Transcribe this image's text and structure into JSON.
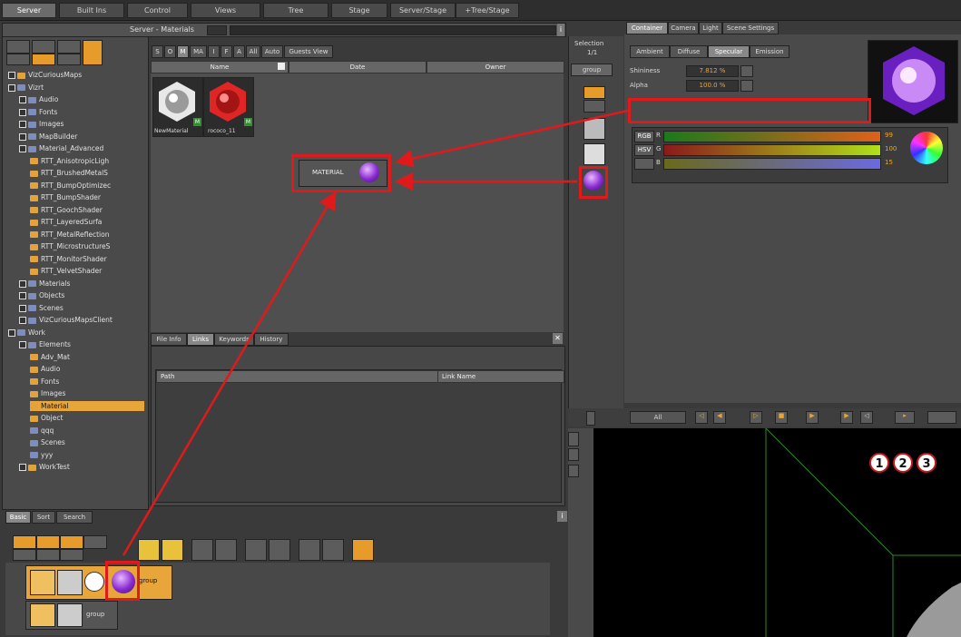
{
  "top_tabs": [
    "Server",
    "Built Ins",
    "Control",
    "Views",
    "Tree",
    "Stage",
    "Server/Stage",
    "+Tree/Stage"
  ],
  "server_panel": {
    "title": "Server - Materials",
    "info": "i"
  },
  "filter_tabs": [
    "S",
    "O",
    "M",
    "MA",
    "I",
    "F",
    "A",
    "All",
    "Auto",
    "Guests View"
  ],
  "columns": {
    "name": "Name",
    "date": "Date",
    "owner": "Owner"
  },
  "tree": [
    {
      "label": "VizCuriousMaps",
      "level": 0,
      "color": "orange"
    },
    {
      "label": "Vizrt",
      "level": 0,
      "color": "blue"
    },
    {
      "label": "Audio",
      "level": 1,
      "color": "blue"
    },
    {
      "label": "Fonts",
      "level": 1,
      "color": "blue"
    },
    {
      "label": "Images",
      "level": 1,
      "color": "blue"
    },
    {
      "label": "MapBuilder",
      "level": 1,
      "color": "blue"
    },
    {
      "label": "Material_Advanced",
      "level": 1,
      "color": "blue"
    },
    {
      "label": "RTT_AnisotropicLigh",
      "level": 2,
      "color": "orange"
    },
    {
      "label": "RTT_BrushedMetalS",
      "level": 2,
      "color": "orange"
    },
    {
      "label": "RTT_BumpOptimizec",
      "level": 2,
      "color": "orange"
    },
    {
      "label": "RTT_BumpShader",
      "level": 2,
      "color": "orange"
    },
    {
      "label": "RTT_GoochShader",
      "level": 2,
      "color": "orange"
    },
    {
      "label": "RTT_LayeredSurfa",
      "level": 2,
      "color": "orange"
    },
    {
      "label": "RTT_MetalReflection",
      "level": 2,
      "color": "orange"
    },
    {
      "label": "RTT_MicrostructureS",
      "level": 2,
      "color": "orange"
    },
    {
      "label": "RTT_MonitorShader",
      "level": 2,
      "color": "orange"
    },
    {
      "label": "RTT_VelvetShader",
      "level": 2,
      "color": "orange"
    },
    {
      "label": "Materials",
      "level": 1,
      "color": "blue"
    },
    {
      "label": "Objects",
      "level": 1,
      "color": "blue"
    },
    {
      "label": "Scenes",
      "level": 1,
      "color": "blue"
    },
    {
      "label": "VizCuriousMapsClient",
      "level": 1,
      "color": "blue"
    },
    {
      "label": "Work",
      "level": 0,
      "color": "blue"
    },
    {
      "label": "Elements",
      "level": 1,
      "color": "blue"
    },
    {
      "label": "Adv_Mat",
      "level": 2,
      "color": "orange"
    },
    {
      "label": "Audio",
      "level": 2,
      "color": "orange"
    },
    {
      "label": "Fonts",
      "level": 2,
      "color": "orange"
    },
    {
      "label": "Images",
      "level": 2,
      "color": "orange"
    },
    {
      "label": "Material",
      "level": 2,
      "color": "orange",
      "selected": true
    },
    {
      "label": "Object",
      "level": 2,
      "color": "orange"
    },
    {
      "label": "qqq",
      "level": 2,
      "color": "blue"
    },
    {
      "label": "Scenes",
      "level": 2,
      "color": "blue"
    },
    {
      "label": "yyy",
      "level": 2,
      "color": "blue"
    },
    {
      "label": "WorkTest",
      "level": 1,
      "color": "orange"
    }
  ],
  "thumbs": [
    {
      "label": "NewMaterial",
      "badge": "M",
      "color": "#cfcfcf"
    },
    {
      "label": "rococo_11",
      "badge": "M",
      "color": "#e02525"
    }
  ],
  "material_chip": "MATERIAL",
  "info_tabs": [
    "File Info",
    "Links",
    "Keywords",
    "History"
  ],
  "links_columns": {
    "path": "Path",
    "link_name": "Link Name"
  },
  "bottom_tabs": [
    "Basic",
    "Sort",
    "Search"
  ],
  "scene_tree": [
    {
      "label": "group"
    },
    {
      "label": "group"
    }
  ],
  "selection": {
    "label": "Selection",
    "count": "1/1",
    "name": "group"
  },
  "editor_tabs": [
    "Container",
    "Camera",
    "Light",
    "Scene Settings"
  ],
  "material_tabs": [
    "Ambient",
    "Diffuse",
    "Specular",
    "Emission"
  ],
  "shininess": {
    "label": "Shininess",
    "value": "7.812 %"
  },
  "alpha": {
    "label": "Alpha",
    "value": "100.0 %"
  },
  "color_modes": [
    "RGB",
    "HSV"
  ],
  "rgb": [
    {
      "channel": "R",
      "value": "99"
    },
    {
      "channel": "G",
      "value": "100"
    },
    {
      "channel": "B",
      "value": "15"
    }
  ],
  "timeline": {
    "filter": "All"
  },
  "numbers": [
    "1",
    "2",
    "3"
  ],
  "colors": {
    "accent": "#e79b2a",
    "red": "#e01a1a",
    "purple": "#7a2cc7"
  }
}
